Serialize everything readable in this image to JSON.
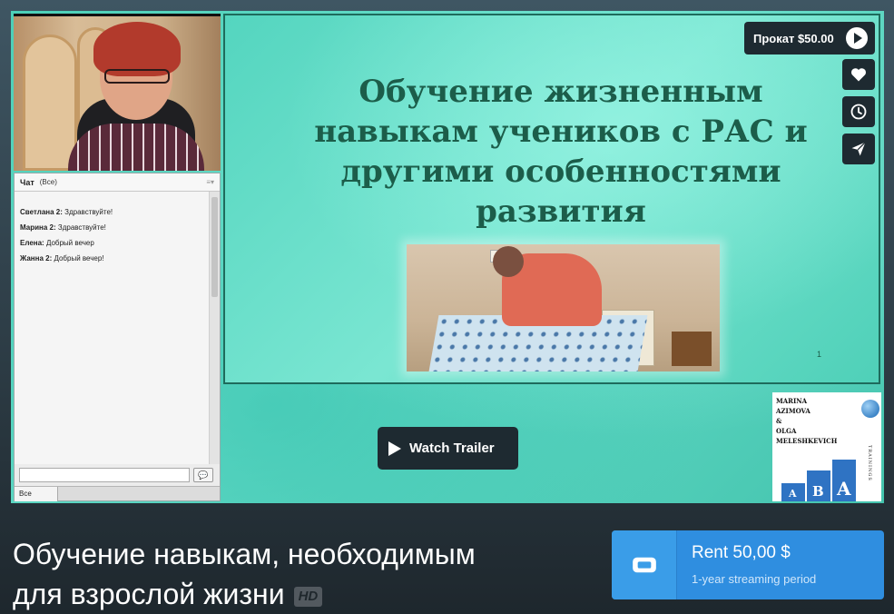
{
  "video": {
    "chat": {
      "title": "Чат",
      "scope": "(Все)",
      "messages": [
        {
          "author": "Светлана 2:",
          "text": " Здравствуйте!"
        },
        {
          "author": "Марина 2:",
          "text": " Здравствуйте!"
        },
        {
          "author": "Елена:",
          "text": " Добрый вечер"
        },
        {
          "author": "Жанна  2:",
          "text": " Добрый вечер!"
        }
      ],
      "footer_scope": "Все"
    },
    "slide": {
      "title_lines": [
        "Обучение жизненным",
        "навыкам учеников с РАС и",
        "другими особенностями",
        "развития"
      ],
      "slide_number": "1"
    },
    "logo": {
      "lines": [
        "MARINA",
        "AZIMOVA",
        "&",
        "OLGA",
        "MELESHKEVICH"
      ],
      "letters": [
        "A",
        "B",
        "A"
      ],
      "vertical_text": "TRAININGS"
    }
  },
  "actions": {
    "rent_badge": "Прокат $50.00",
    "like_icon": "heart-icon",
    "watchlater_icon": "clock-icon",
    "share_icon": "send-icon",
    "watch_trailer": "Watch Trailer"
  },
  "info": {
    "title_line1": "Обучение навыкам, необходимым",
    "title_line2": "для взрослой жизни",
    "hd_badge": "HD",
    "rent_label": "Rent 50,00 $",
    "rent_sub": "1-year streaming period"
  },
  "colors": {
    "accent": "#2f8ee0",
    "button_dark": "#1e2a31",
    "slide_bg": "#5fd9c4",
    "slide_title": "#1c5d4a"
  }
}
